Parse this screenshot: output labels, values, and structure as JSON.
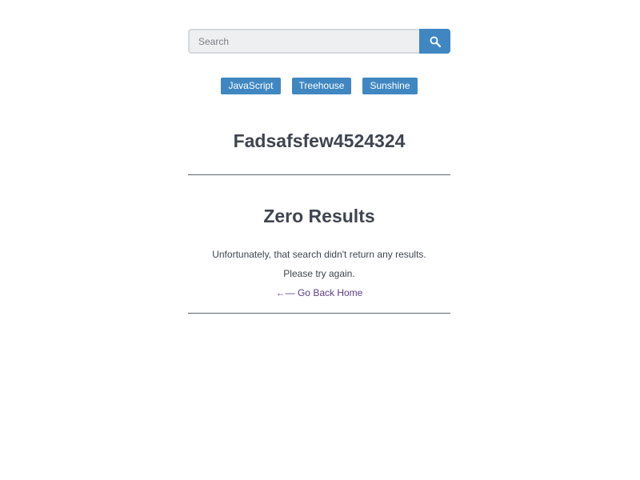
{
  "search": {
    "placeholder": "Search",
    "value": "",
    "button_icon": "search-icon"
  },
  "tags": [
    {
      "label": "JavaScript"
    },
    {
      "label": "Treehouse"
    },
    {
      "label": "Sunshine"
    }
  ],
  "query": {
    "title": "Fadsafsfew4524324"
  },
  "results": {
    "heading": "Zero Results",
    "message_line1": "Unfortunately, that search didn't return any results.",
    "message_line2": "Please try again.",
    "back_link": "←— Go Back Home"
  },
  "colors": {
    "accent": "#4087c2",
    "text": "#3f4550",
    "link": "#5b3c88",
    "input_bg": "#edeff0"
  }
}
